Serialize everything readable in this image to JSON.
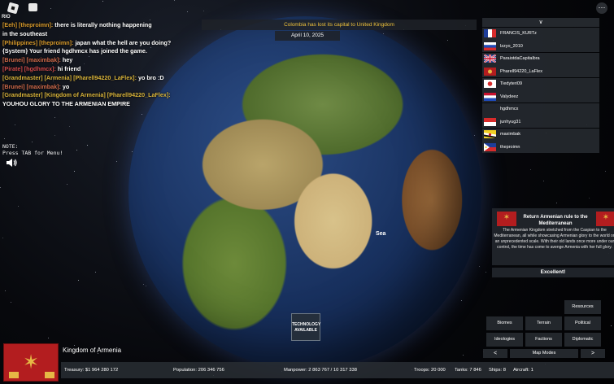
{
  "colors": {
    "banner_text": "#f0c33b",
    "armenia_red": "#b31d1f",
    "armenia_gold": "#e6b845"
  },
  "top": {
    "player_count": "RIO",
    "menu_icon": "⋯"
  },
  "chat": [
    {
      "parts": [
        {
          "t": "[Eeh] [theproimn]: ",
          "c": "#d89a2b"
        },
        {
          "t": "there is literally nothing happening",
          "c": "#ffffff"
        }
      ]
    },
    {
      "parts": [
        {
          "t": "in the southeast",
          "c": "#ffffff"
        }
      ]
    },
    {
      "parts": [
        {
          "t": "[Philippines] [theproimn]: ",
          "c": "#d89a2b"
        },
        {
          "t": "japan what the hell are you doing?",
          "c": "#ffffff"
        }
      ]
    },
    {
      "parts": [
        {
          "t": "{System} Your friend hgdhmcx has joined the game.",
          "c": "#ffffff"
        }
      ]
    },
    {
      "parts": [
        {
          "t": "[Brunei] [maximbak]: ",
          "c": "#d06a4a"
        },
        {
          "t": "hey",
          "c": "#ffffff"
        }
      ]
    },
    {
      "parts": [
        {
          "t": "[Pirate] [hgdhmcx]: ",
          "c": "#d34b4b"
        },
        {
          "t": "hi friend",
          "c": "#ffffff"
        }
      ]
    },
    {
      "parts": [
        {
          "t": "[Grandmaster] [Armenia] [Pharell94220_LaFlex]: ",
          "c": "#d8b33a"
        },
        {
          "t": "yo bro :D",
          "c": "#ffffff"
        }
      ]
    },
    {
      "parts": [
        {
          "t": "[Brunei] [maximbak]: ",
          "c": "#d06a4a"
        },
        {
          "t": "yo",
          "c": "#ffffff"
        }
      ]
    },
    {
      "parts": [
        {
          "t": "[Grandmaster] [Kingdom of Armenia] [Pharell94220_LaFlex]:",
          "c": "#d8b33a"
        }
      ]
    },
    {
      "parts": [
        {
          "t": "YOUHOU GLORY TO THE ARMENIAN EMPIRE",
          "c": "#ffffff"
        }
      ]
    }
  ],
  "note": {
    "line1": "NOTE:",
    "line2": "Press TAB for Menu!"
  },
  "banner": {
    "text": "Colombia has lost its capital to United Kingdom",
    "date": "April 10, 2025"
  },
  "player_list": {
    "toggle": "∨",
    "players": [
      {
        "name": "FRANCIS_KURTz",
        "flag": "france"
      },
      {
        "name": "lzzyo_2010",
        "flag": "russia"
      },
      {
        "name": "ParaiotdaCapitalbra",
        "flag": "uk"
      },
      {
        "name": "Pharell94220_LaFlex",
        "flag": "armenia"
      },
      {
        "name": "Tiedyteri09",
        "flag": "japan"
      },
      {
        "name": "Valydeez",
        "flag": "netherlands"
      },
      {
        "name": "hgdhmcx",
        "flag": "none"
      },
      {
        "name": "junhyug31",
        "flag": "indonesia"
      },
      {
        "name": "maximbak",
        "flag": "brunei"
      },
      {
        "name": "theproimn",
        "flag": "philippines"
      }
    ]
  },
  "mission": {
    "title": "Return Armenian rule to the Mediterranean",
    "description": "The Armenian Kingdom stretched from the Caspian to the Mediterranean, all while showcasing Armenian glory to the world on an unprecedented scale. With their old lands once more under our control, the time has come to avenge Armenia with her full glory.",
    "confirm": "Excellent!"
  },
  "map": {
    "sea_label": "Sea",
    "tech": "TECHNOLOGY AVAILABLE"
  },
  "buttons": {
    "resources": "Resources",
    "biomes": "Biomes",
    "terrain": "Terrain",
    "political": "Political",
    "ideologies": "Ideologies",
    "factions": "Factions",
    "diplomatic": "Diplomatic",
    "prev": "<",
    "map_modes": "Map Modes",
    "next": ">"
  },
  "country": {
    "name": "Kingdom of Armenia",
    "treasury": "Treasury:  $1 964 280 172",
    "population": "Population: 206 346 756",
    "manpower": "Manpower:  2 863 767  /  10 317 338",
    "troops": "Troops: 20 000",
    "tanks": "Tanks: 7 846",
    "ships": "Ships: 8",
    "aircraft": "Aircraft: 1"
  }
}
